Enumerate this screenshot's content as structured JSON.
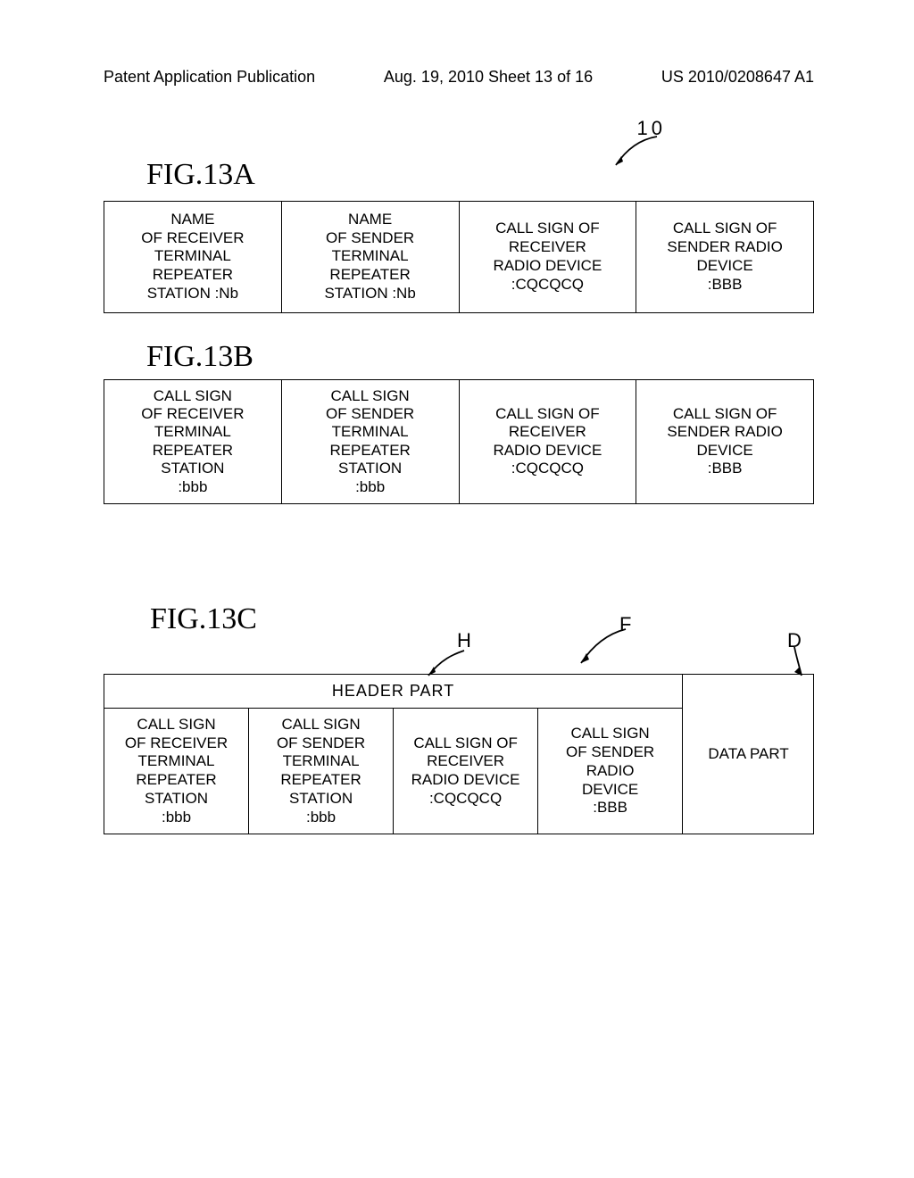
{
  "header": {
    "left": "Patent Application Publication",
    "center": "Aug. 19, 2010  Sheet 13 of 16",
    "right": "US 2010/0208647 A1"
  },
  "fig13a": {
    "label": "FIG.13A",
    "ref": "10",
    "cells": [
      "NAME\nOF RECEIVER\nTERMINAL\nREPEATER\nSTATION :Nb",
      "NAME\nOF SENDER\nTERMINAL\nREPEATER\nSTATION :Nb",
      "CALL SIGN OF\nRECEIVER\nRADIO DEVICE\n:CQCQCQ",
      "CALL SIGN OF\nSENDER RADIO\nDEVICE\n:BBB"
    ]
  },
  "fig13b": {
    "label": "FIG.13B",
    "cells": [
      "CALL SIGN\nOF RECEIVER\nTERMINAL\nREPEATER\nSTATION\n:bbb",
      "CALL SIGN\nOF SENDER\nTERMINAL\nREPEATER\nSTATION\n:bbb",
      "CALL SIGN OF\nRECEIVER\nRADIO DEVICE\n:CQCQCQ",
      "CALL SIGN OF\nSENDER RADIO\nDEVICE\n:BBB"
    ]
  },
  "fig13c": {
    "label": "FIG.13C",
    "letters": {
      "H": "H",
      "F": "F",
      "D": "D"
    },
    "header_part": "HEADER PART",
    "cells": [
      "CALL SIGN\nOF RECEIVER\nTERMINAL\nREPEATER\nSTATION\n:bbb",
      "CALL SIGN\nOF SENDER\nTERMINAL\nREPEATER\nSTATION\n:bbb",
      "CALL SIGN OF\nRECEIVER\nRADIO DEVICE\n:CQCQCQ",
      "CALL SIGN\nOF SENDER\nRADIO\nDEVICE\n:BBB"
    ],
    "data_part": "DATA PART"
  }
}
